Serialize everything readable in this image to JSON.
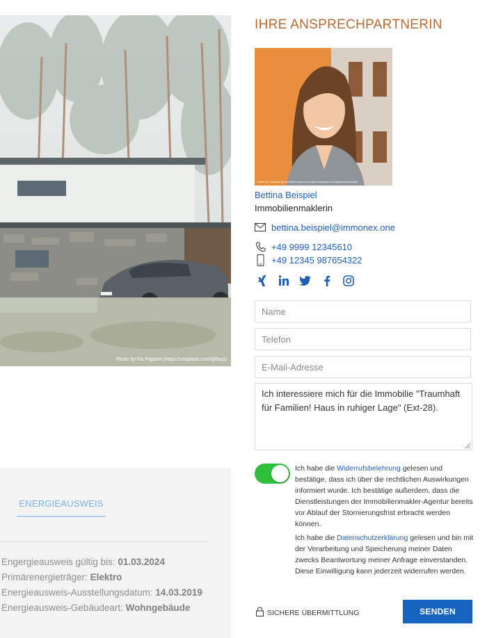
{
  "photo": {
    "credit": "Photo by Flo Pappert (https://unsplash.com/@flopt)"
  },
  "energy": {
    "tab_label": "ENERGIEAUSWEIS",
    "items": [
      {
        "label": "Engergieausweis gültig bis: ",
        "value": "01.03.2024"
      },
      {
        "label": "Primärenergieträger: ",
        "value": "Elektro"
      },
      {
        "label": "Energieausweis-Ausstellungsdatum: ",
        "value": "14.03.2019"
      },
      {
        "label": "Energieausweis-Gebäudeart: ",
        "value": "Wohngebäude"
      }
    ]
  },
  "contact": {
    "title": "IHRE ANSPRECHPARTNERIN",
    "photo_credit": "Photo by Christina @ wocintechchat.com (https://unsplash.com/@wocintechchat)",
    "name": "Bettina Beispiel",
    "role": "Immobilienmaklerin",
    "email": "bettina.beispiel@immonex.one",
    "phone": "+49 9999 12345610",
    "mobile": "+49 12345 987654322",
    "social": [
      "xing-icon",
      "linkedin-icon",
      "twitter-icon",
      "facebook-icon",
      "instagram-icon"
    ]
  },
  "form": {
    "name_placeholder": "Name",
    "phone_placeholder": "Telefon",
    "email_placeholder": "E-Mail-Adresse",
    "message_value": "Ich interessiere mich für die Immobilie \"Traumhaft für Familien! Haus in ruhiger Lage\" (Ext-28).",
    "toggle_on": true,
    "consent1_pre": "Ich habe die ",
    "consent1_link": "Widerrufsbelehrung",
    "consent1_post": " gelesen und bestätige, dass ich über die rechtlichen Auswirkungen informiert wurde. Ich bestätige außerdem, dass die Dienstleistungen der Immobilienmakler-Agentur bereits vor Ablauf der Stornierungsfrist erbracht werden können.",
    "consent2_pre": "Ich habe die ",
    "consent2_link": "Datenschutzerklärung",
    "consent2_post": " gelesen und bin mit der Verarbeitung und Speicherung meiner Daten zwecks Beantwortung meiner Anfrage einverstanden. Diese Einwilligung kann jederzeit widerrufen werden.",
    "secure_label": "SICHERE ÜBERMITTLUNG",
    "submit_label": "SENDEN"
  },
  "colors": {
    "accent": "#b86a35",
    "link": "#1f5fb6",
    "button": "#1664c0",
    "toggle": "#2fbf3a"
  }
}
